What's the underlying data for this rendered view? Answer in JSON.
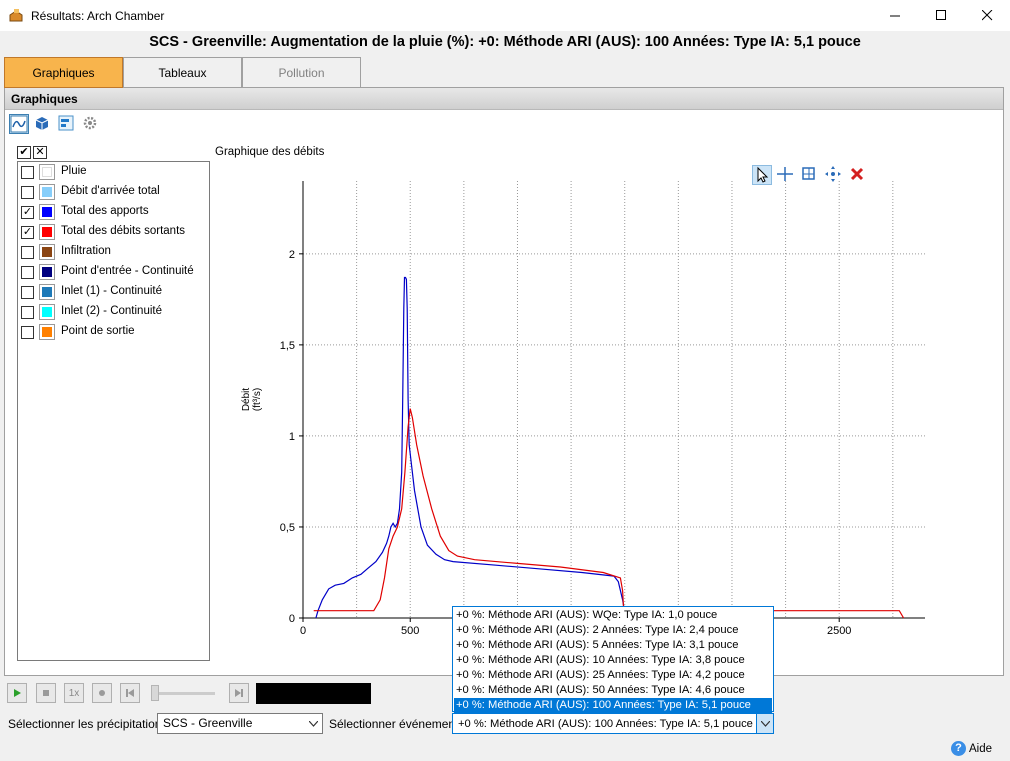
{
  "window": {
    "title": "Résultats: Arch Chamber"
  },
  "heading": "SCS - Greenville: Augmentation de la pluie (%): +0: Méthode ARI (AUS): 100 Années: Type IA: 5,1 pouce",
  "tabs": [
    {
      "label": "Graphiques",
      "state": "active"
    },
    {
      "label": "Tableaux",
      "state": "normal"
    },
    {
      "label": "Pollution",
      "state": "disabled"
    }
  ],
  "panel": {
    "title": "Graphiques"
  },
  "legend": {
    "items": [
      {
        "label": "Pluie",
        "checked": false,
        "color": "#ffffff"
      },
      {
        "label": "Débit d'arrivée total",
        "checked": false,
        "color": "#87cefa"
      },
      {
        "label": "Total des apports",
        "checked": true,
        "color": "#0000ff"
      },
      {
        "label": "Total des débits sortants",
        "checked": true,
        "color": "#ff0000"
      },
      {
        "label": "Infiltration",
        "checked": false,
        "color": "#8b4513"
      },
      {
        "label": "Point d'entrée - Continuité",
        "checked": false,
        "color": "#000080"
      },
      {
        "label": "Inlet (1) - Continuité",
        "checked": false,
        "color": "#1e7ab8"
      },
      {
        "label": "Inlet (2) - Continuité",
        "checked": false,
        "color": "#00ffff"
      },
      {
        "label": "Point de sortie",
        "checked": false,
        "color": "#ff8000"
      }
    ]
  },
  "chart_title": "Graphique des débits",
  "chart_data": {
    "type": "line",
    "title": "Graphique des débits",
    "ylabel": "Débit (ft³/s)",
    "xlabel": "",
    "xlim": [
      0,
      2900
    ],
    "ylim": [
      0,
      2.4
    ],
    "x_ticks": [
      0,
      500,
      2500
    ],
    "y_ticks": [
      0,
      0.5,
      1,
      1.5,
      2
    ],
    "y_tick_labels": [
      "0",
      "0,5",
      "1",
      "1,5",
      "2"
    ],
    "grid": true,
    "series": [
      {
        "color": "#0000c8",
        "points": [
          [
            60,
            0
          ],
          [
            70,
            0.04
          ],
          [
            90,
            0.1
          ],
          [
            120,
            0.16
          ],
          [
            150,
            0.18
          ],
          [
            190,
            0.19
          ],
          [
            230,
            0.22
          ],
          [
            270,
            0.24
          ],
          [
            300,
            0.27
          ],
          [
            340,
            0.31
          ],
          [
            370,
            0.36
          ],
          [
            390,
            0.41
          ],
          [
            400,
            0.45
          ],
          [
            410,
            0.5
          ],
          [
            420,
            0.52
          ],
          [
            430,
            0.5
          ],
          [
            440,
            0.52
          ],
          [
            450,
            0.6
          ],
          [
            460,
            0.8
          ],
          [
            465,
            1.2
          ],
          [
            470,
            1.7
          ],
          [
            473,
            1.87
          ],
          [
            478,
            1.87
          ],
          [
            482,
            1.86
          ],
          [
            486,
            1.7
          ],
          [
            490,
            1.2
          ],
          [
            495,
            0.95
          ],
          [
            505,
            0.85
          ],
          [
            520,
            0.7
          ],
          [
            550,
            0.5
          ],
          [
            580,
            0.4
          ],
          [
            620,
            0.35
          ],
          [
            660,
            0.32
          ],
          [
            700,
            0.31
          ],
          [
            900,
            0.29
          ],
          [
            1100,
            0.27
          ],
          [
            1300,
            0.25
          ],
          [
            1450,
            0.23
          ],
          [
            1470,
            0.2
          ],
          [
            1490,
            0.1
          ],
          [
            1500,
            0.03
          ],
          [
            1510,
            0
          ]
        ]
      },
      {
        "color": "#e00000",
        "points": [
          [
            50,
            0.04
          ],
          [
            320,
            0.04
          ],
          [
            330,
            0.04
          ],
          [
            360,
            0.1
          ],
          [
            380,
            0.22
          ],
          [
            400,
            0.38
          ],
          [
            420,
            0.45
          ],
          [
            440,
            0.5
          ],
          [
            460,
            0.6
          ],
          [
            475,
            0.8
          ],
          [
            490,
            1.05
          ],
          [
            500,
            1.15
          ],
          [
            510,
            1.1
          ],
          [
            530,
            0.95
          ],
          [
            560,
            0.78
          ],
          [
            600,
            0.6
          ],
          [
            640,
            0.45
          ],
          [
            680,
            0.37
          ],
          [
            720,
            0.34
          ],
          [
            800,
            0.32
          ],
          [
            1000,
            0.3
          ],
          [
            1200,
            0.28
          ],
          [
            1400,
            0.25
          ],
          [
            1480,
            0.22
          ],
          [
            1490,
            0.15
          ],
          [
            1495,
            0.04
          ],
          [
            2780,
            0.04
          ],
          [
            2800,
            0
          ]
        ]
      }
    ]
  },
  "playback": {
    "speed_label": "1x"
  },
  "precip": {
    "label": "Sélectionner les précipitations:",
    "value": "SCS - Greenville"
  },
  "event": {
    "label": "Sélectionner événement:",
    "value": "+0 %: Méthode ARI (AUS): 100 Années: Type IA: 5,1 pouce",
    "options": [
      "+0 %: Méthode ARI (AUS): WQe: Type IA: 1,0 pouce",
      "+0 %: Méthode ARI (AUS): 2 Années: Type IA: 2,4 pouce",
      "+0 %: Méthode ARI (AUS): 5 Années: Type IA: 3,1 pouce",
      "+0 %: Méthode ARI (AUS): 10 Années: Type IA: 3,8 pouce",
      "+0 %: Méthode ARI (AUS): 25 Années: Type IA: 4,2 pouce",
      "+0 %: Méthode ARI (AUS): 50 Années: Type IA: 4,6 pouce",
      "+0 %: Méthode ARI (AUS): 100 Années: Type IA: 5,1 pouce"
    ],
    "selected_index": 6
  },
  "help": {
    "label": "Aide"
  }
}
